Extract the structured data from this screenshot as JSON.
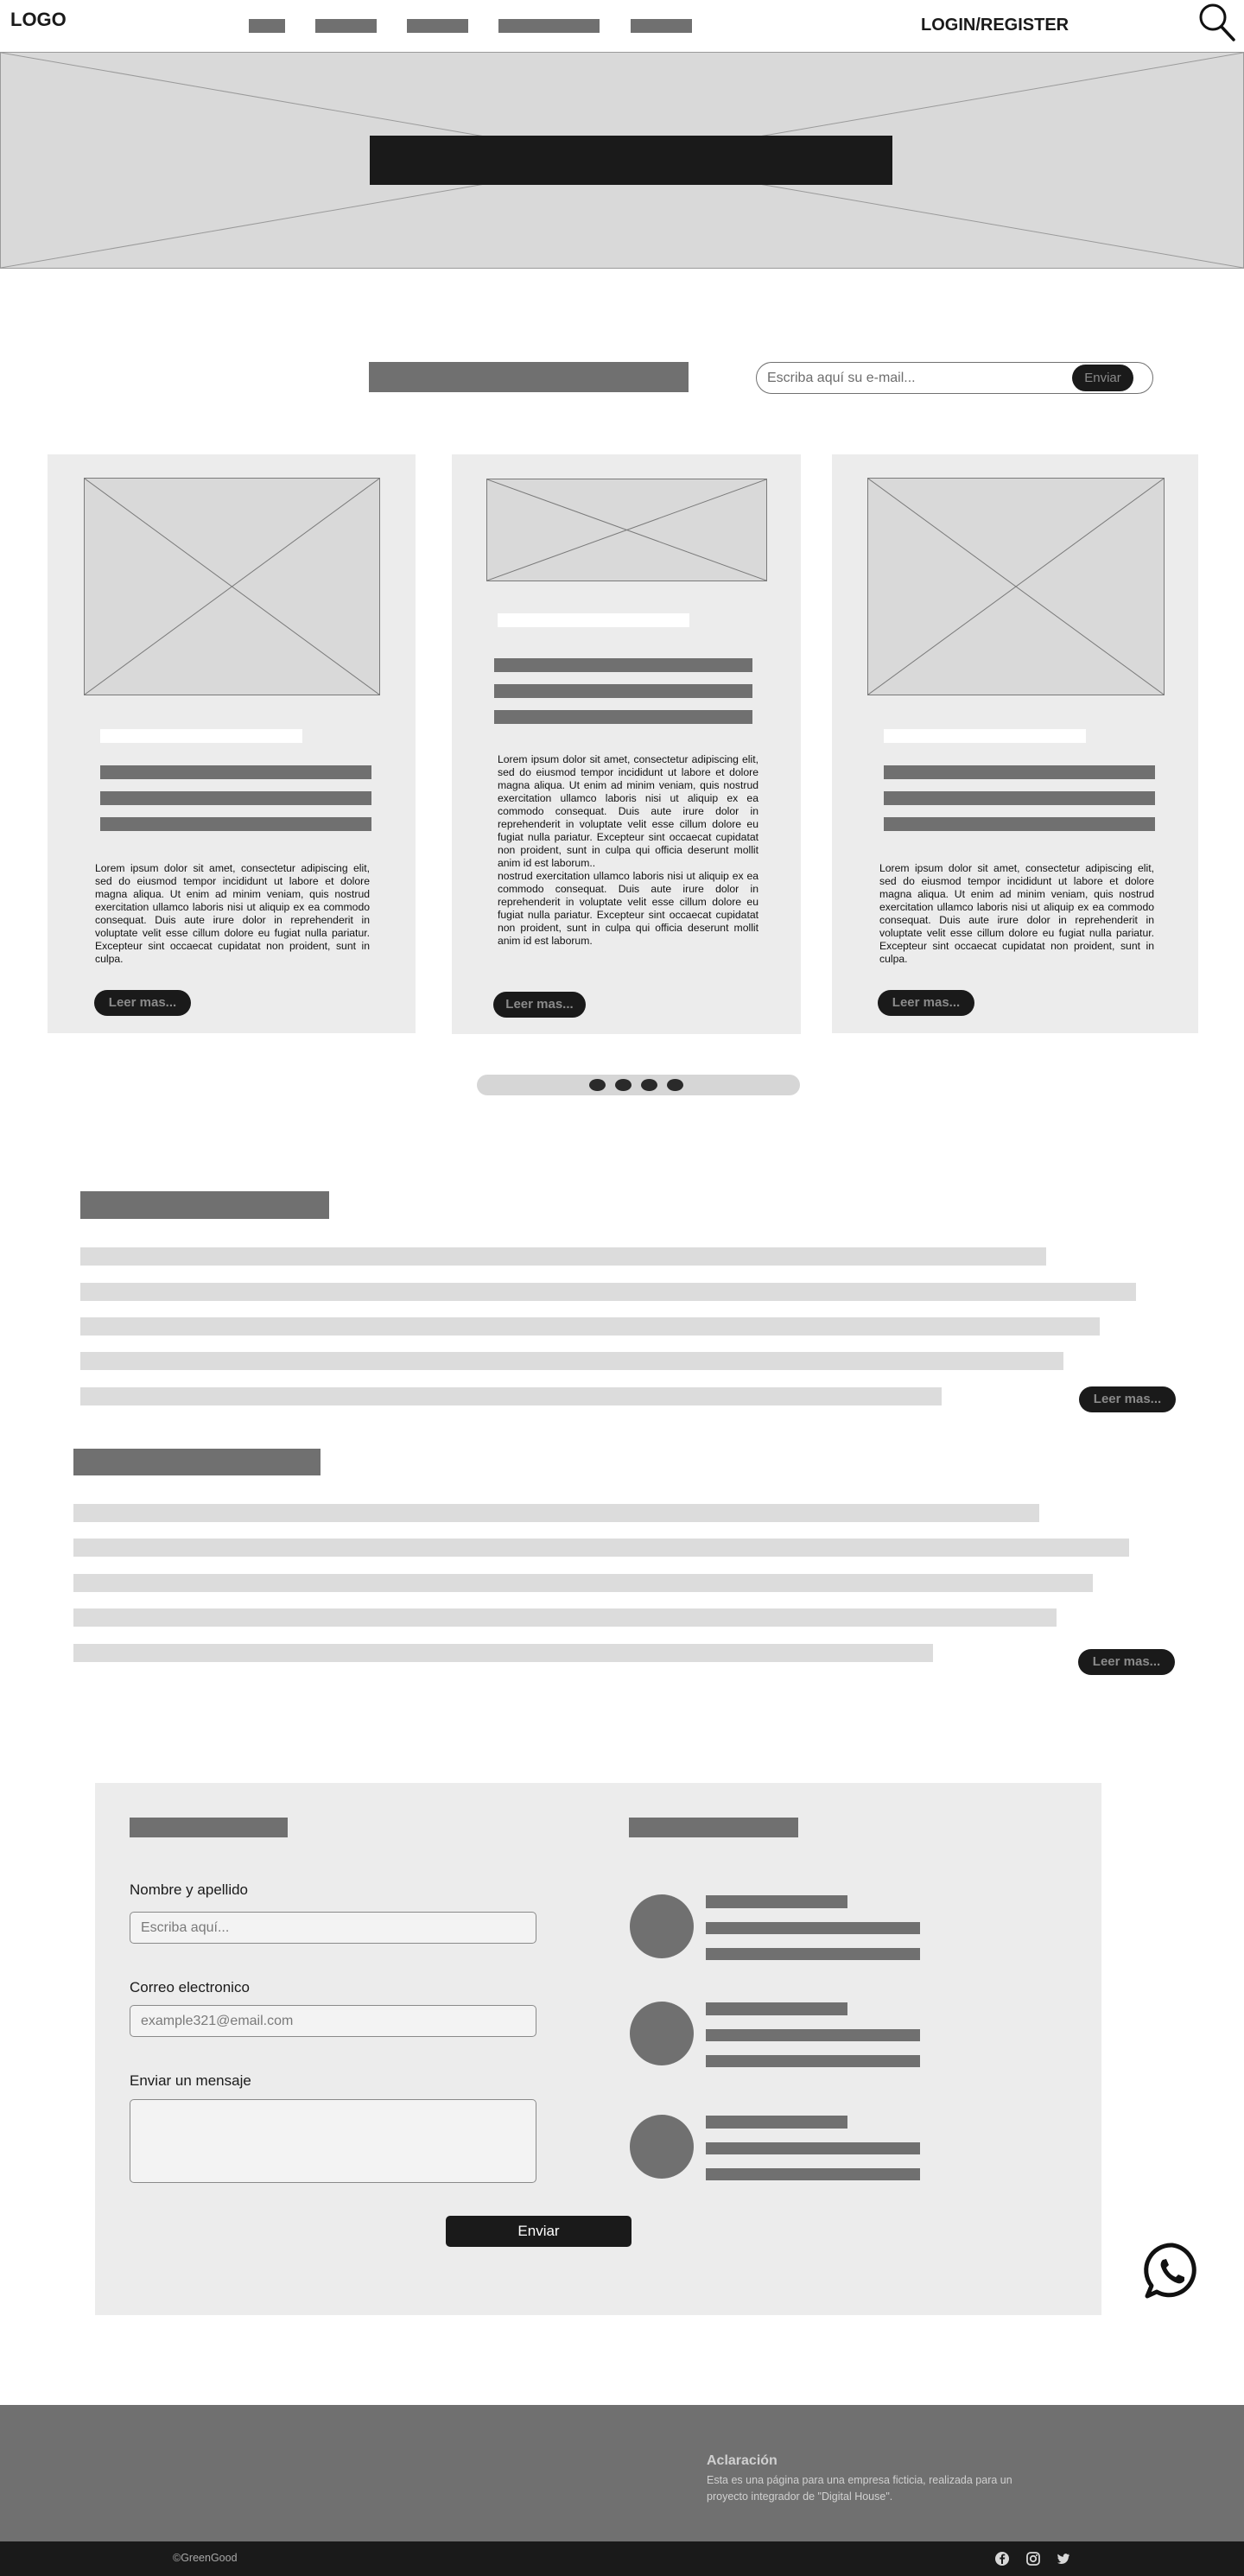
{
  "header": {
    "logo": "LOGO",
    "nav_items": [
      "",
      "",
      "",
      "",
      ""
    ],
    "login_label": "LOGIN/REGISTER"
  },
  "newsletter": {
    "placeholder": "Escriba aquí su e-mail...",
    "button_label": "Enviar"
  },
  "cards": [
    {
      "body": "Lorem ipsum dolor sit amet, consectetur adipiscing elit, sed do eiusmod tempor incididunt ut labore et dolore magna aliqua. Ut enim ad minim veniam, quis nostrud exercitation ullamco laboris nisi ut aliquip ex ea commodo consequat. Duis aute irure dolor in reprehenderit in voluptate velit esse cillum dolore eu fugiat nulla pariatur. Excepteur sint occaecat cupidatat non proident, sunt in culpa.",
      "button_label": "Leer mas..."
    },
    {
      "body": "Lorem ipsum dolor sit amet, consectetur adipiscing elit, sed do eiusmod tempor incididunt ut labore et dolore magna aliqua. Ut enim ad minim veniam, quis nostrud exercitation ullamco laboris nisi ut aliquip ex ea commodo consequat. Duis aute irure dolor in reprehenderit in voluptate velit esse cillum dolore eu fugiat nulla pariatur. Excepteur sint occaecat cupidatat non proident, sunt in culpa qui officia deserunt mollit anim id est laborum..",
      "body2": "nostrud exercitation ullamco laboris nisi ut aliquip ex ea commodo consequat. Duis aute irure dolor in reprehenderit in voluptate velit esse cillum dolore eu fugiat nulla pariatur. Excepteur sint occaecat cupidatat non proident, sunt in culpa qui officia deserunt mollit anim id est laborum.",
      "button_label": "Leer mas..."
    },
    {
      "body": "Lorem ipsum dolor sit amet, consectetur adipiscing elit, sed do eiusmod tempor incididunt ut labore et dolore magna aliqua. Ut enim ad minim veniam, quis nostrud exercitation ullamco laboris nisi ut aliquip ex ea commodo consequat. Duis aute irure dolor in reprehenderit in voluptate velit esse cillum dolore eu fugiat nulla pariatur. Excepteur sint occaecat cupidatat non proident, sunt in culpa.",
      "button_label": "Leer mas..."
    }
  ],
  "sections": [
    {
      "button_label": "Leer mas..."
    },
    {
      "button_label": "Leer mas..."
    }
  ],
  "contact": {
    "name_label": "Nombre y apellido",
    "name_placeholder": "Escriba aquí...",
    "email_label": "Correo electronico",
    "email_placeholder": "example321@email.com",
    "message_label": "Enviar un mensaje",
    "submit_label": "Enviar"
  },
  "footer": {
    "title": "Aclaración",
    "text": "Esta es una página para una empresa ficticia, realizada para un proyecto integrador de \"Digital House\".",
    "copyright": "©GreenGood"
  },
  "icons": [
    "search-icon",
    "whatsapp-icon",
    "facebook-icon",
    "instagram-icon",
    "twitter-icon"
  ]
}
